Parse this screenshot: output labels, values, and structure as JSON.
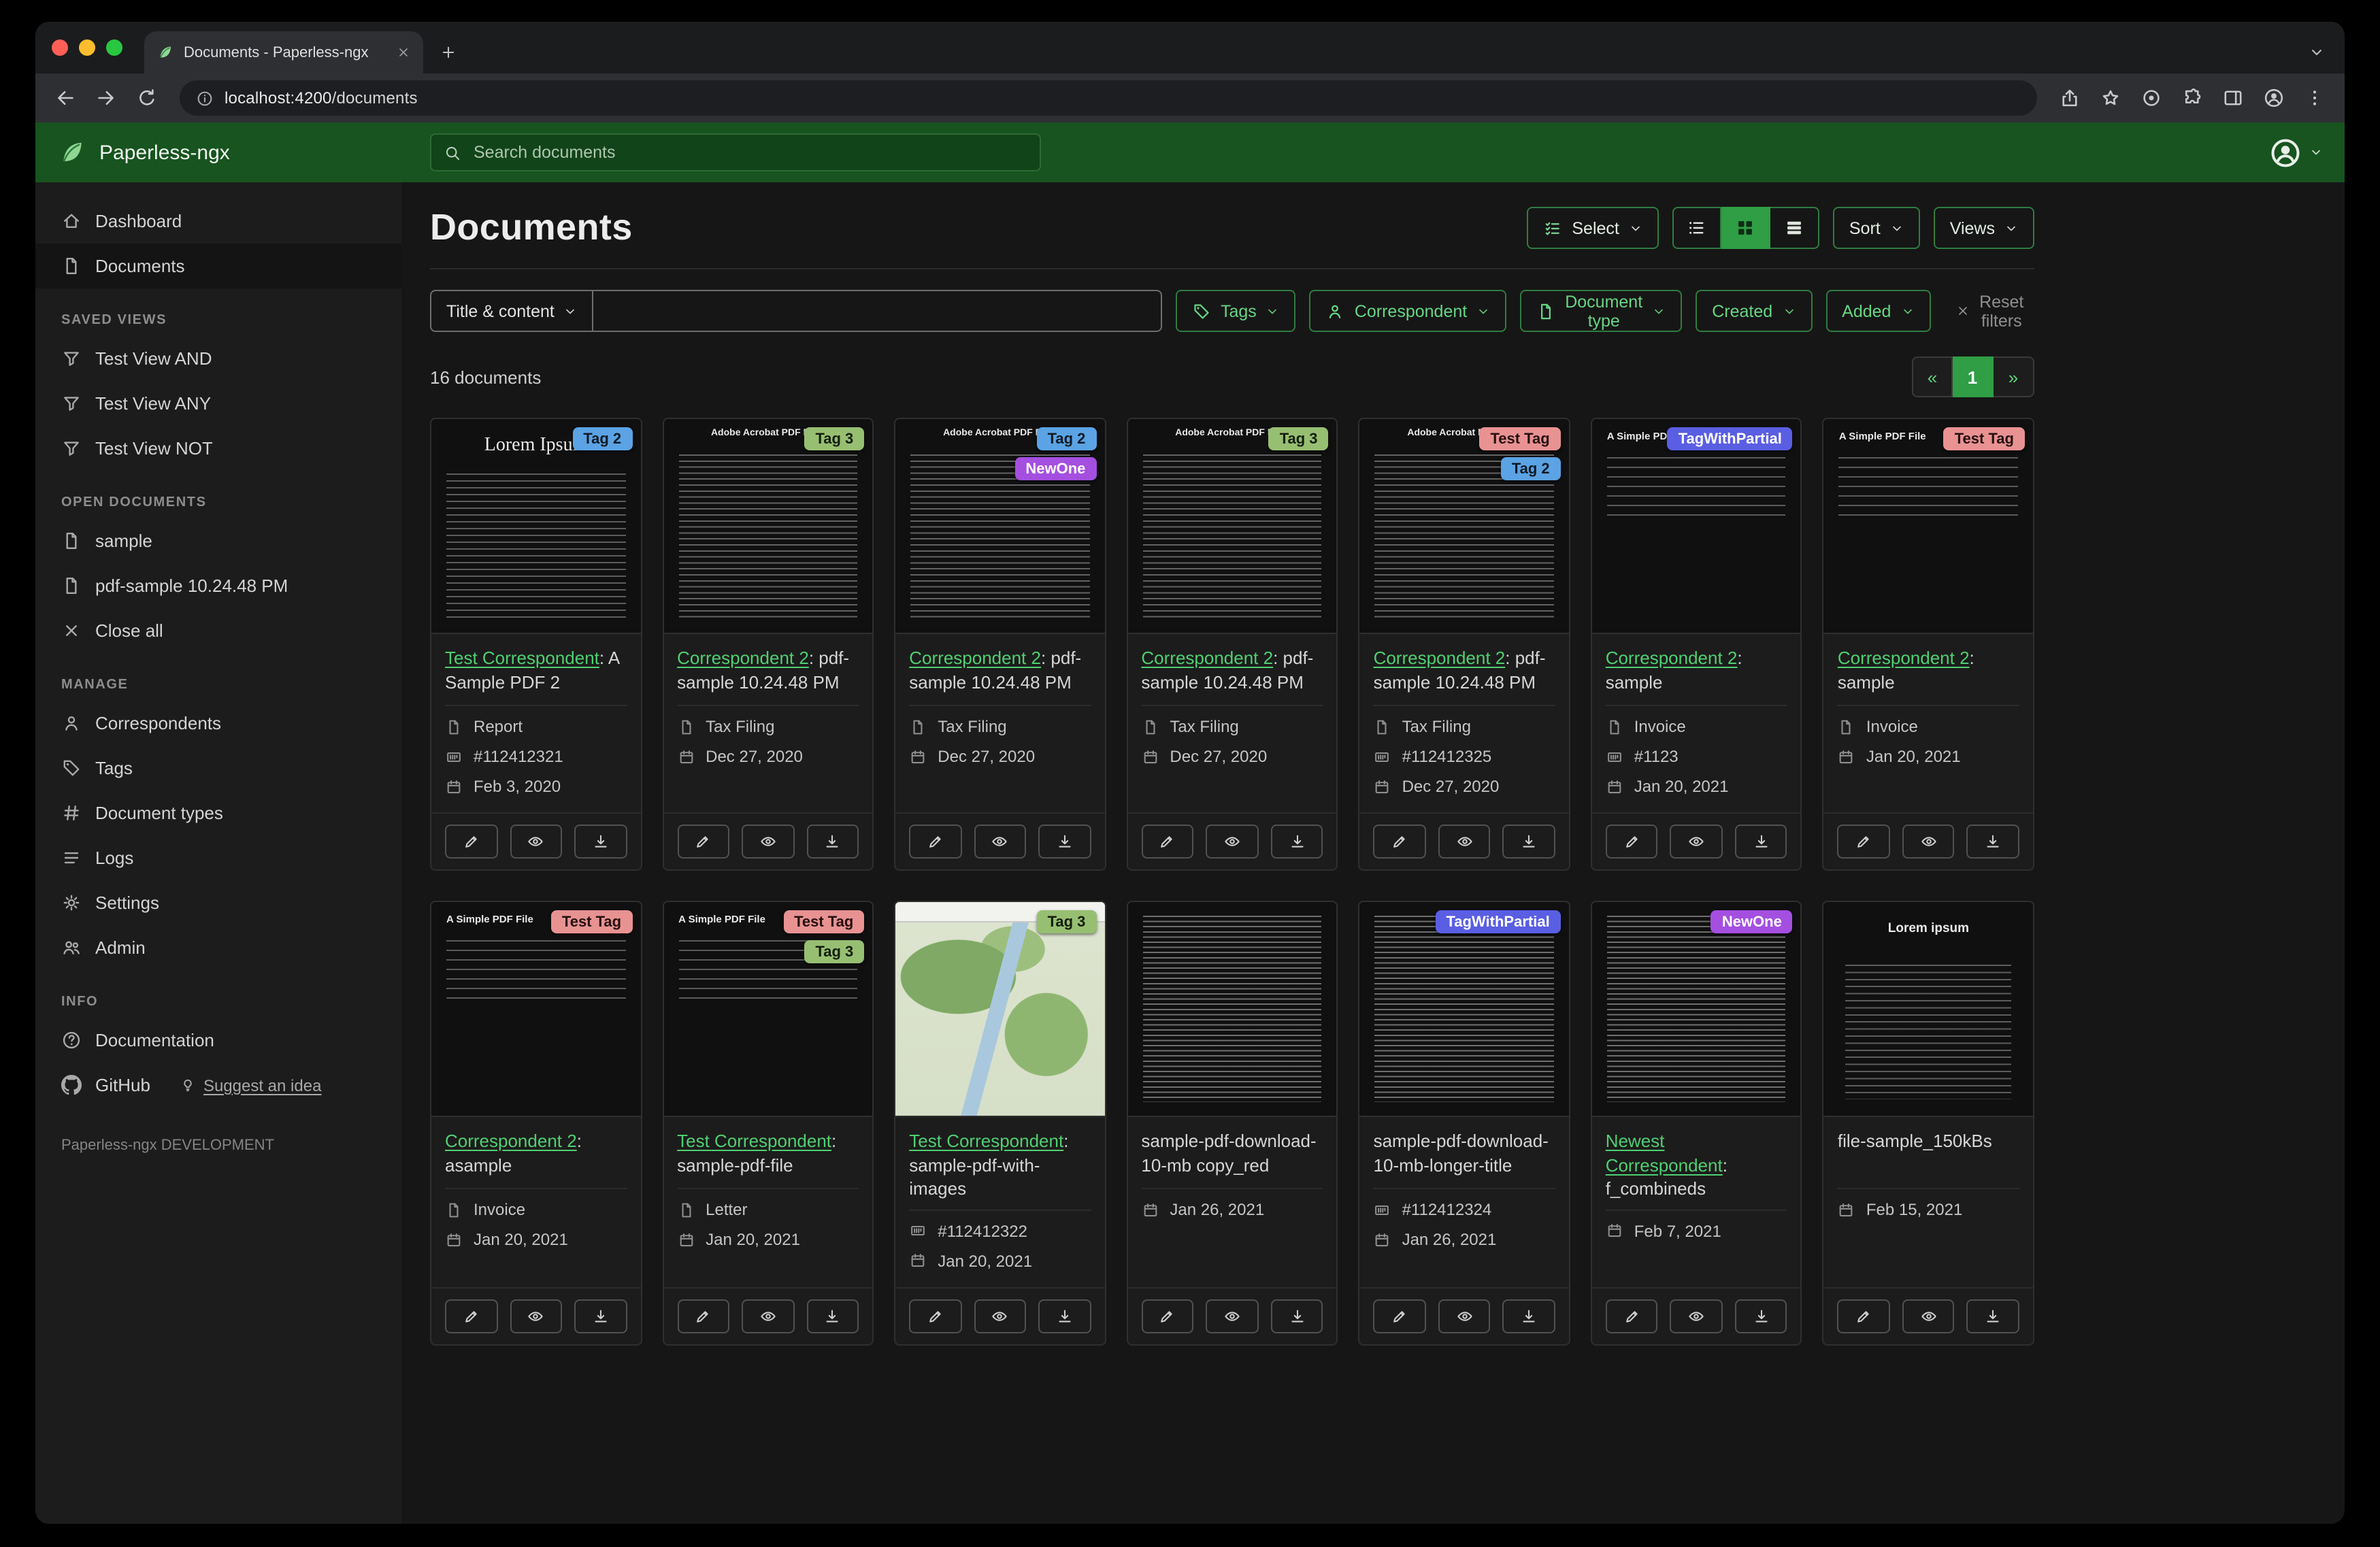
{
  "browser": {
    "tab_title": "Documents - Paperless-ngx",
    "url_host": "localhost:4200",
    "url_path": "/documents"
  },
  "app_header": {
    "app_name": "Paperless-ngx",
    "search_placeholder": "Search documents"
  },
  "sidebar": {
    "sections": [
      {
        "items": [
          {
            "icon": "home",
            "label": "Dashboard"
          },
          {
            "icon": "file",
            "label": "Documents",
            "active": true
          }
        ]
      },
      {
        "header": "SAVED VIEWS",
        "items": [
          {
            "icon": "funnel",
            "label": "Test View AND"
          },
          {
            "icon": "funnel",
            "label": "Test View ANY"
          },
          {
            "icon": "funnel",
            "label": "Test View NOT"
          }
        ]
      },
      {
        "header": "OPEN DOCUMENTS",
        "items": [
          {
            "icon": "file",
            "label": "sample"
          },
          {
            "icon": "file",
            "label": "pdf-sample 10.24.48 PM"
          },
          {
            "icon": "close",
            "label": "Close all"
          }
        ]
      },
      {
        "header": "MANAGE",
        "items": [
          {
            "icon": "person",
            "label": "Correspondents"
          },
          {
            "icon": "tag",
            "label": "Tags"
          },
          {
            "icon": "hash",
            "label": "Document types"
          },
          {
            "icon": "list",
            "label": "Logs"
          },
          {
            "icon": "gear",
            "label": "Settings"
          },
          {
            "icon": "people",
            "label": "Admin"
          }
        ]
      },
      {
        "header": "INFO",
        "items": [
          {
            "icon": "question",
            "label": "Documentation"
          },
          {
            "icon": "github",
            "label": "GitHub",
            "extra_link": "Suggest an idea"
          }
        ]
      }
    ],
    "footer": "Paperless-ngx DEVELOPMENT"
  },
  "main": {
    "title": "Documents",
    "select_label": "Select",
    "sort_label": "Sort",
    "views_label": "Views",
    "filters": {
      "title_content": "Title & content",
      "tags": "Tags",
      "correspondent": "Correspondent",
      "document_type": "Document type",
      "created": "Created",
      "added": "Added",
      "reset": "Reset filters"
    },
    "count_label": "16 documents",
    "pagination": {
      "prev": "«",
      "page": "1",
      "next": "»"
    }
  },
  "accent_colors": {
    "header_green": "#17541f",
    "active_green": "#2f9e44",
    "link_green": "#4fd071"
  },
  "tag_palette": {
    "Tag 2": {
      "bg": "#5ba3e4",
      "fg": "#0e1b26"
    },
    "Tag 3": {
      "bg": "#97bf72",
      "fg": "#141d0b"
    },
    "Test Tag": {
      "bg": "#e89292",
      "fg": "#260f0f"
    },
    "NewOne": {
      "bg": "#a44fe0",
      "fg": "#ffffff"
    },
    "TagWithPartial": {
      "bg": "#5a5ee2",
      "fg": "#ffffff"
    }
  },
  "cards": [
    {
      "thumb_variant": "lorem-serif",
      "thumb_heading": "Lorem Ipsum",
      "tags": [
        "Tag 2"
      ],
      "correspondent": "Test Correspondent",
      "title_rest": ": A Sample PDF 2",
      "doc_type": "Report",
      "asn": "#112412321",
      "date": "Feb 3, 2020"
    },
    {
      "thumb_variant": "acrobat",
      "thumb_heading": "Adobe Acrobat PDF Files",
      "tags": [
        "Tag 3"
      ],
      "correspondent": "Correspondent 2",
      "title_rest": ": pdf-sample 10.24.48 PM",
      "doc_type": "Tax Filing",
      "asn": null,
      "date": "Dec 27, 2020"
    },
    {
      "thumb_variant": "acrobat",
      "thumb_heading": "Adobe Acrobat PDF Files",
      "tags": [
        "Tag 2",
        "NewOne"
      ],
      "correspondent": "Correspondent 2",
      "title_rest": ": pdf-sample 10.24.48 PM",
      "doc_type": "Tax Filing",
      "asn": null,
      "date": "Dec 27, 2020"
    },
    {
      "thumb_variant": "acrobat",
      "thumb_heading": "Adobe Acrobat PDF Files",
      "tags": [
        "Tag 3"
      ],
      "correspondent": "Correspondent 2",
      "title_rest": ": pdf-sample 10.24.48 PM",
      "doc_type": "Tax Filing",
      "asn": null,
      "date": "Dec 27, 2020"
    },
    {
      "thumb_variant": "acrobat",
      "thumb_heading": "Adobe Acrobat PDF Files",
      "tags": [
        "Test Tag",
        "Tag 2"
      ],
      "correspondent": "Correspondent 2",
      "title_rest": ": pdf-sample 10.24.48 PM",
      "doc_type": "Tax Filing",
      "asn": "#112412325",
      "date": "Dec 27, 2020"
    },
    {
      "thumb_variant": "simple",
      "thumb_heading": "A Simple PDF File",
      "tags": [
        "TagWithPartial"
      ],
      "correspondent": "Correspondent 2",
      "title_rest": ": sample",
      "doc_type": "Invoice",
      "asn": "#1123",
      "date": "Jan 20, 2021"
    },
    {
      "thumb_variant": "simple",
      "thumb_heading": "A Simple PDF File",
      "tags": [
        "Test Tag"
      ],
      "correspondent": "Correspondent 2",
      "title_rest": ": sample",
      "doc_type": "Invoice",
      "asn": null,
      "date": "Jan 20, 2021"
    },
    {
      "thumb_variant": "simple",
      "thumb_heading": "A Simple PDF File",
      "tags": [
        "Test Tag"
      ],
      "correspondent": "Correspondent 2",
      "title_rest": ": asample",
      "doc_type": "Invoice",
      "asn": null,
      "date": "Jan 20, 2021"
    },
    {
      "thumb_variant": "simple",
      "thumb_heading": "A Simple PDF File",
      "tags": [
        "Test Tag",
        "Tag 3"
      ],
      "correspondent": "Test Correspondent",
      "title_rest": ": sample-pdf-file",
      "doc_type": "Letter",
      "asn": null,
      "date": "Jan 20, 2021"
    },
    {
      "thumb_variant": "map",
      "thumb_heading": null,
      "tags": [
        "Tag 3"
      ],
      "correspondent": "Test Correspondent",
      "title_rest": ": sample-pdf-with-images",
      "doc_type": null,
      "asn": "#112412322",
      "date": "Jan 20, 2021"
    },
    {
      "thumb_variant": "dense",
      "thumb_heading": null,
      "tags": [],
      "correspond": null,
      "correspondent": null,
      "title_plain": "sample-pdf-download-10-mb copy_red",
      "doc_type": null,
      "asn": null,
      "date": "Jan 26, 2021"
    },
    {
      "thumb_variant": "dense",
      "thumb_heading": null,
      "tags": [
        "TagWithPartial"
      ],
      "correspondent": null,
      "title_plain": "sample-pdf-download-10-mb-longer-title",
      "doc_type": null,
      "asn": "#112412324",
      "date": "Jan 26, 2021"
    },
    {
      "thumb_variant": "dense",
      "thumb_heading": null,
      "tags": [
        "NewOne"
      ],
      "correspondent": "Newest Correspondent",
      "title_rest": ": f_combineds",
      "doc_type": null,
      "asn": null,
      "date": "Feb 7, 2021"
    },
    {
      "thumb_variant": "lorem-center",
      "thumb_heading": "Lorem ipsum",
      "tags": [],
      "correspondent": null,
      "title_plain": "file-sample_150kBs",
      "doc_type": null,
      "asn": null,
      "date": "Feb 15, 2021"
    }
  ]
}
